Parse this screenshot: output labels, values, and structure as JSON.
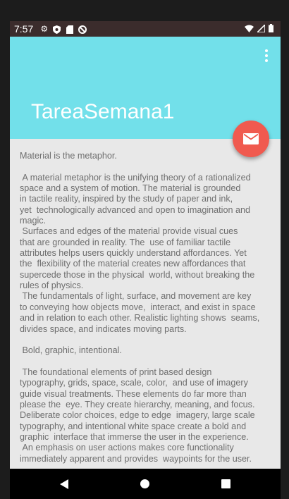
{
  "status_bar": {
    "time": "7:57",
    "left_icons": [
      "gear-icon",
      "shield-icon",
      "sd-card-icon",
      "no-sync-icon"
    ],
    "right_icons": [
      "wifi-icon",
      "signal-icon",
      "battery-icon"
    ]
  },
  "app_bar": {
    "title": "TareaSemana1",
    "background_color": "#72e0ea",
    "overflow_icon": "more-vert-icon"
  },
  "fab": {
    "icon": "email-icon",
    "color": "#f05a4f"
  },
  "content": {
    "text": "Material is the metaphor.\n\n A material metaphor is the unifying theory of a rationalized\nspace and a system of motion. The material is grounded\nin tactile reality, inspired by the study of paper and ink,\nyet  technologically advanced and open to imagination and\nmagic.\n Surfaces and edges of the material provide visual cues\nthat are grounded in reality. The  use of familiar tactile\nattributes helps users quickly understand affordances. Yet\nthe  flexibility of the material creates new affordances that\nsupercede those in the physical  world, without breaking the\nrules of physics.\n The fundamentals of light, surface, and movement are key\nto conveying how objects move,  interact, and exist in space\nand in relation to each other. Realistic lighting shows  seams,\ndivides space, and indicates moving parts.\n\n Bold, graphic, intentional.\n\n The foundational elements of print based design\ntypography, grids, space, scale, color,  and use of imagery\nguide visual treatments. These elements do far more than\nplease the  eye. They create hierarchy, meaning, and focus.\nDeliberate color choices, edge to edge  imagery, large scale\ntypography, and intentional white space create a bold and\ngraphic  interface that immerse the user in the experience.\n An emphasis on user actions makes core functionality\nimmediately apparent and provides  waypoints for the user."
  },
  "nav_bar": {
    "buttons": [
      "back-icon",
      "home-icon",
      "recents-icon"
    ]
  }
}
